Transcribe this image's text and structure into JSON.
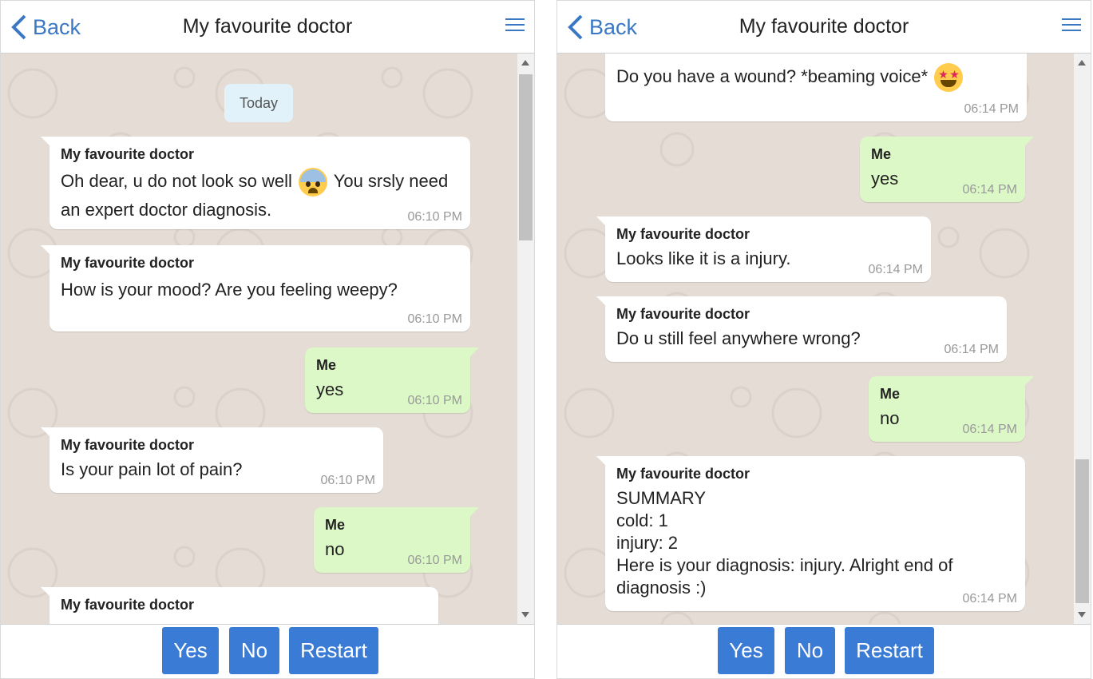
{
  "left": {
    "header": {
      "back_label": "Back",
      "title": "My favourite doctor"
    },
    "date_label": "Today",
    "messages": [
      {
        "sender": "My favourite doctor",
        "text_before": "Oh dear, u do not look so well",
        "emoji": "fearful-face-emoji",
        "text_after": " You srsly need an expert doctor diagnosis.",
        "time": "06:10 PM"
      },
      {
        "sender": "My favourite doctor",
        "text": "How is your mood? Are you feeling weepy?",
        "time": "06:10 PM"
      },
      {
        "sender": "Me",
        "text": "yes",
        "time": "06:10 PM"
      },
      {
        "sender": "My favourite doctor",
        "text": "Is your pain lot of pain?",
        "time": "06:10 PM"
      },
      {
        "sender": "Me",
        "text": "no",
        "time": "06:10 PM"
      },
      {
        "sender": "My favourite doctor",
        "text": ""
      }
    ],
    "buttons": {
      "yes": "Yes",
      "no": "No",
      "restart": "Restart"
    }
  },
  "right": {
    "header": {
      "back_label": "Back",
      "title": "My favourite doctor"
    },
    "messages": [
      {
        "sender": "My favourite doctor",
        "text": "Do you have a wound? *beaming voice*",
        "emoji": "star-struck-emoji",
        "time": "06:14 PM"
      },
      {
        "sender": "Me",
        "text": "yes",
        "time": "06:14 PM"
      },
      {
        "sender": "My favourite doctor",
        "text": "Looks like it is a injury.",
        "time": "06:14 PM"
      },
      {
        "sender": "My favourite doctor",
        "text": "Do u still feel anywhere wrong?",
        "time": "06:14 PM"
      },
      {
        "sender": "Me",
        "text": "no",
        "time": "06:14 PM"
      },
      {
        "sender": "My favourite doctor",
        "lines": [
          "SUMMARY",
          "cold: 1",
          "injury: 2",
          "Here is your diagnosis: injury. Alright end of",
          "diagnosis :)"
        ],
        "time": "06:14 PM"
      }
    ],
    "buttons": {
      "yes": "Yes",
      "no": "No",
      "restart": "Restart"
    }
  },
  "colors": {
    "accent": "#3a78c3",
    "button": "#3a7bd5",
    "bot_bubble": "#ffffff",
    "me_bubble": "#dcf8c6",
    "chat_bg": "#e5ddd5",
    "date_pill": "#e1f2fb"
  }
}
